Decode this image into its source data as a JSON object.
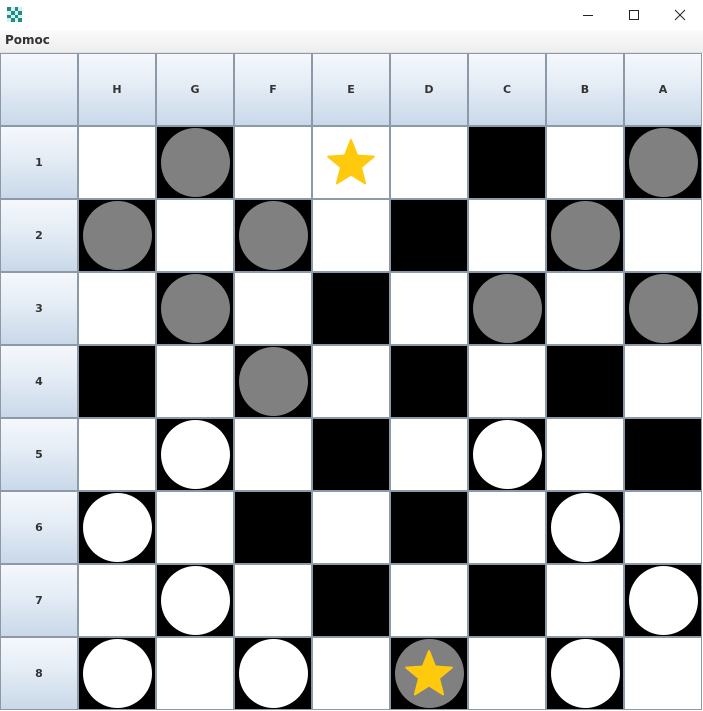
{
  "window": {
    "title": "",
    "icon": "checkerboard-app-icon",
    "controls": [
      "minimize-icon",
      "maximize-icon",
      "close-icon"
    ]
  },
  "menu": {
    "items": [
      {
        "label": "Pomoc"
      }
    ]
  },
  "board": {
    "columns": [
      "H",
      "G",
      "F",
      "E",
      "D",
      "C",
      "B",
      "A"
    ],
    "rows": [
      "1",
      "2",
      "3",
      "4",
      "5",
      "6",
      "7",
      "8"
    ],
    "colors": {
      "light": "#ffffff",
      "dark": "#000000",
      "gray_piece": "#808080",
      "white_piece": "#ffffff",
      "star": "#ffc90e"
    },
    "cells": [
      [
        "L",
        "D:gray",
        "L",
        "L:whiteking",
        "L",
        "D",
        "L",
        "D:gray"
      ],
      [
        "D:gray",
        "L",
        "D:gray",
        "L",
        "D",
        "L",
        "D:gray",
        "L"
      ],
      [
        "L",
        "D:gray",
        "L",
        "D",
        "L",
        "D:gray",
        "L",
        "D:gray"
      ],
      [
        "D",
        "L",
        "D:gray",
        "L",
        "D",
        "L",
        "D",
        "L"
      ],
      [
        "L",
        "D:white",
        "L",
        "D",
        "L",
        "D:white",
        "L",
        "D"
      ],
      [
        "D:white",
        "L",
        "D",
        "L",
        "D",
        "L",
        "D:white",
        "L"
      ],
      [
        "L",
        "D:white",
        "L",
        "D",
        "L",
        "D",
        "L",
        "D:white"
      ],
      [
        "D:white",
        "L",
        "D:white",
        "L",
        "D:grayking",
        "L",
        "D:white",
        "L"
      ]
    ]
  }
}
